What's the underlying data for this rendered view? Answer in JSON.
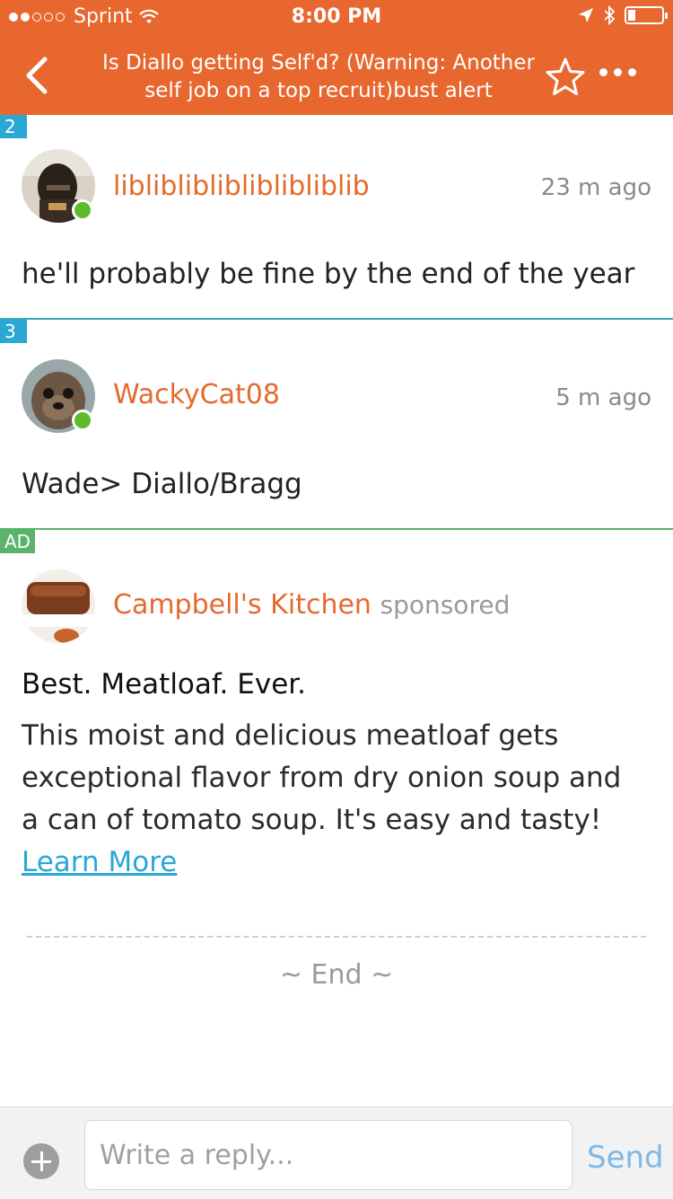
{
  "status": {
    "carrier": "Sprint",
    "time": "8:00 PM"
  },
  "nav": {
    "title": "Is Diallo getting Self'd? (Warning: Another self job on a top recruit)bust alert"
  },
  "posts": [
    {
      "number": "2",
      "username": "liblibliblibliblibliblib",
      "time": "23 m ago",
      "text": "he'll probably be fine by the end of the year"
    },
    {
      "number": "3",
      "username": "WackyCat08",
      "time": "5 m ago",
      "text": "Wade> Diallo/Bragg"
    }
  ],
  "ad": {
    "tag": "AD",
    "name": "Campbell's Kitchen",
    "sponsored": "sponsored",
    "title": "Best. Meatloaf. Ever.",
    "body": "This moist and delicious meatloaf gets exceptional flavor from dry onion soup and a can of tomato soup. It's easy and tasty!",
    "link": "Learn More"
  },
  "end_text": "~ End ~",
  "reply": {
    "placeholder": "Write a reply...",
    "send_label": "Send"
  },
  "colors": {
    "brand": "#e8672f",
    "username": "#e36a2e",
    "link": "#2aa7d5",
    "online": "#5fbb2c",
    "ad_tag": "#5bb36b"
  }
}
